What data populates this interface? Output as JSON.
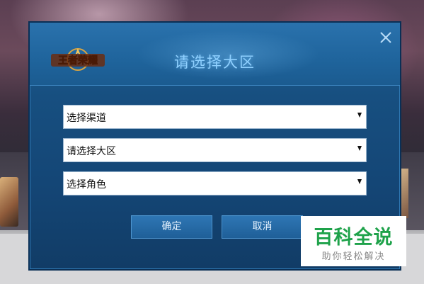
{
  "dialog": {
    "title": "请选择大区",
    "logo_text": "王者荣耀",
    "close_icon": "close-icon"
  },
  "selects": [
    {
      "label": "选择渠道"
    },
    {
      "label": "请选择大区"
    },
    {
      "label": "选择角色"
    }
  ],
  "buttons": {
    "confirm": "确定",
    "cancel": "取消"
  },
  "watermark": {
    "title": "百科全说",
    "subtitle": "助你轻松解决"
  },
  "colors": {
    "title": "#8fd0ff",
    "dialog_bg": "#174f80",
    "watermark_green": "#1ea24a"
  }
}
